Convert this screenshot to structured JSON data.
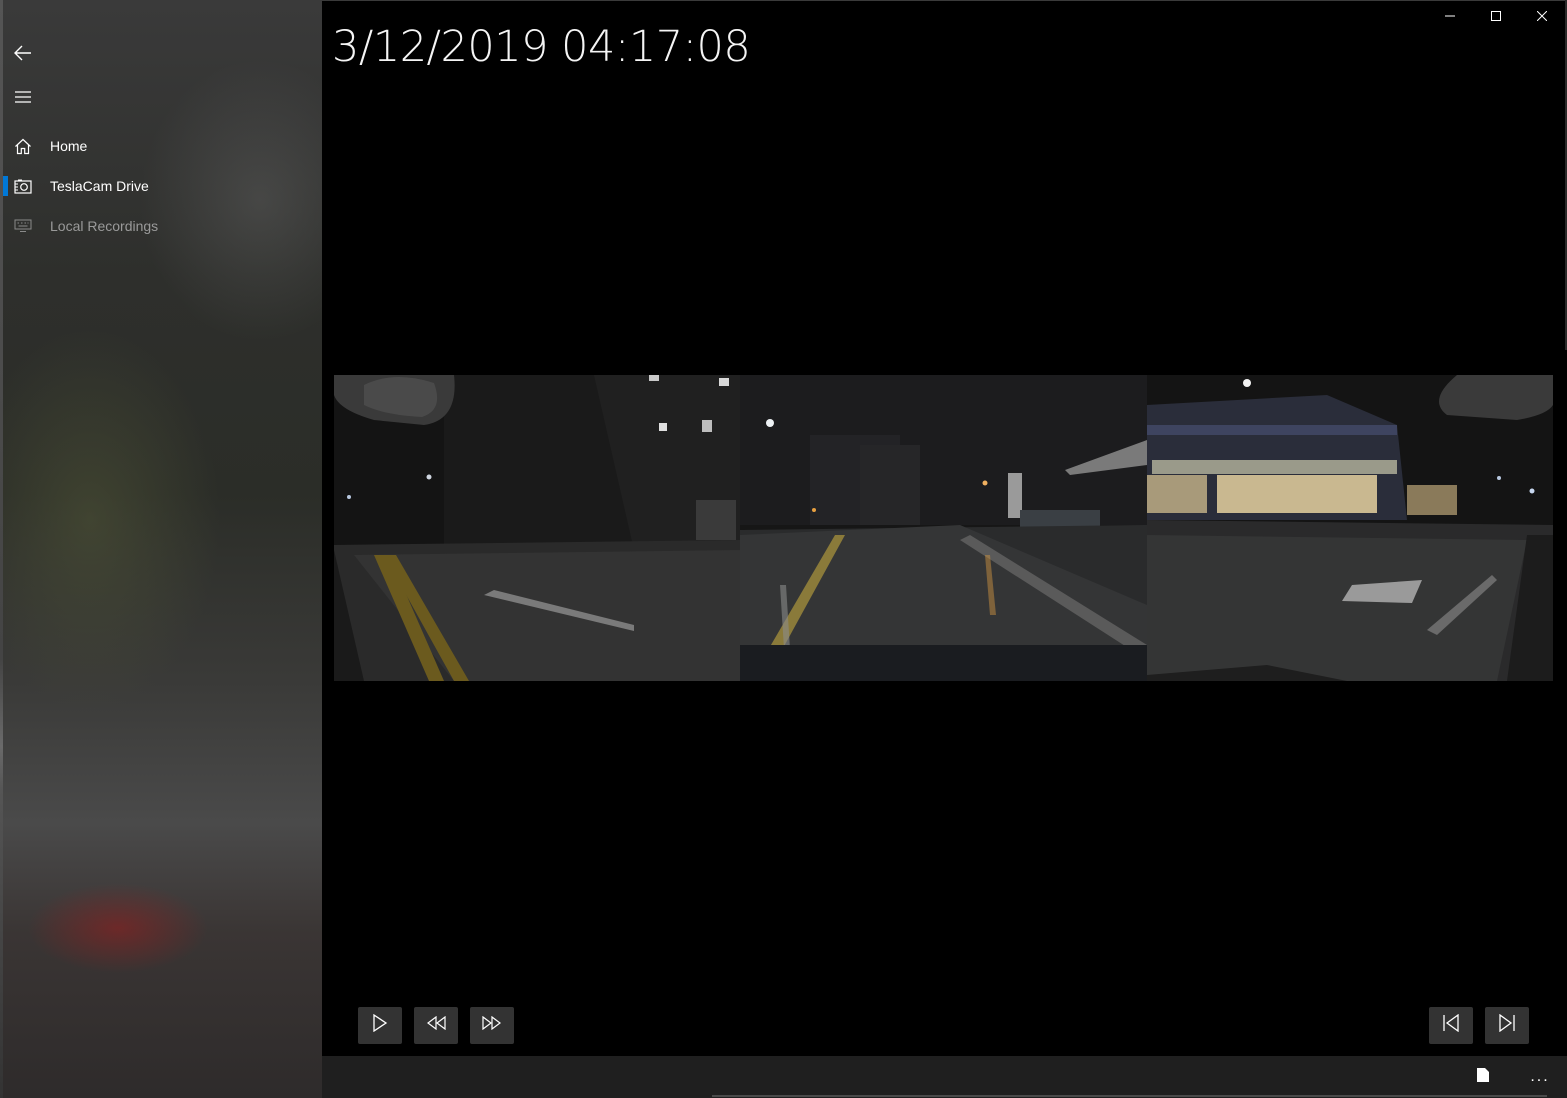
{
  "window": {
    "minimize_icon": "minimize-icon",
    "maximize_icon": "maximize-icon",
    "close_icon": "close-icon"
  },
  "sidebar": {
    "back_icon": "back-arrow-icon",
    "menu_icon": "hamburger-menu-icon",
    "items": [
      {
        "label": "Home",
        "icon": "home-icon",
        "selected": false,
        "enabled": true
      },
      {
        "label": "TeslaCam Drive",
        "icon": "camera-icon",
        "selected": true,
        "enabled": true
      },
      {
        "label": "Local Recordings",
        "icon": "keyboard-icon",
        "selected": false,
        "enabled": false
      }
    ],
    "accent_color": "#0078d7"
  },
  "player": {
    "timestamp": "3/12/2019 04:17:08",
    "cameras": [
      {
        "name": "left-repeater-camera"
      },
      {
        "name": "front-camera"
      },
      {
        "name": "right-repeater-camera"
      }
    ],
    "controls": {
      "play_icon": "play-icon",
      "rewind_icon": "rewind-icon",
      "fast_forward_icon": "fast-forward-icon",
      "previous_icon": "skip-previous-icon",
      "next_icon": "skip-next-icon"
    }
  },
  "command_bar": {
    "page_icon": "page-icon",
    "more_label": "..."
  }
}
